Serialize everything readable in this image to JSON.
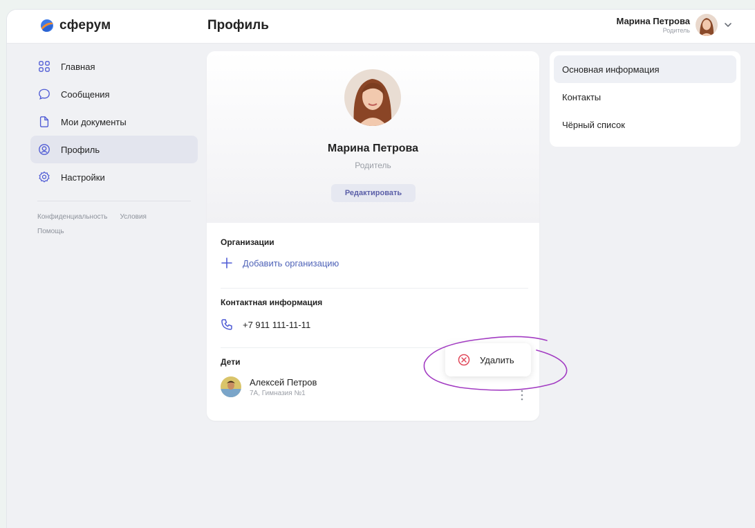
{
  "brand": {
    "name": "сферум"
  },
  "header": {
    "title": "Профиль",
    "user_name": "Марина Петрова",
    "user_role": "Родитель"
  },
  "sidebar": {
    "items": [
      {
        "label": "Главная",
        "icon": "grid-icon"
      },
      {
        "label": "Сообщения",
        "icon": "message-icon"
      },
      {
        "label": "Мои документы",
        "icon": "document-icon"
      },
      {
        "label": "Профиль",
        "icon": "profile-icon",
        "active": true
      },
      {
        "label": "Настройки",
        "icon": "gear-icon"
      }
    ],
    "footer": {
      "privacy": "Конфиденциальность",
      "terms": "Условия",
      "help": "Помощь"
    }
  },
  "profile": {
    "name": "Марина Петрова",
    "role": "Родитель",
    "edit_label": "Редактировать",
    "organizations": {
      "title": "Организации",
      "add_label": "Добавить организацию"
    },
    "contacts": {
      "title": "Контактная информация",
      "phone": "+7 911 111-11-11"
    },
    "children": {
      "title": "Дети",
      "items": [
        {
          "name": "Алексей Петров",
          "details": "7А, Гимназия №1"
        }
      ]
    }
  },
  "right_tabs": [
    {
      "label": "Основная информация",
      "active": true
    },
    {
      "label": "Контакты"
    },
    {
      "label": "Чёрный список"
    }
  ],
  "context_menu": {
    "delete_label": "Удалить"
  },
  "colors": {
    "accent": "#4f63b8",
    "active_bg": "#e3e5ee",
    "delete": "#e0485a",
    "annotation": "#a23bc2"
  }
}
